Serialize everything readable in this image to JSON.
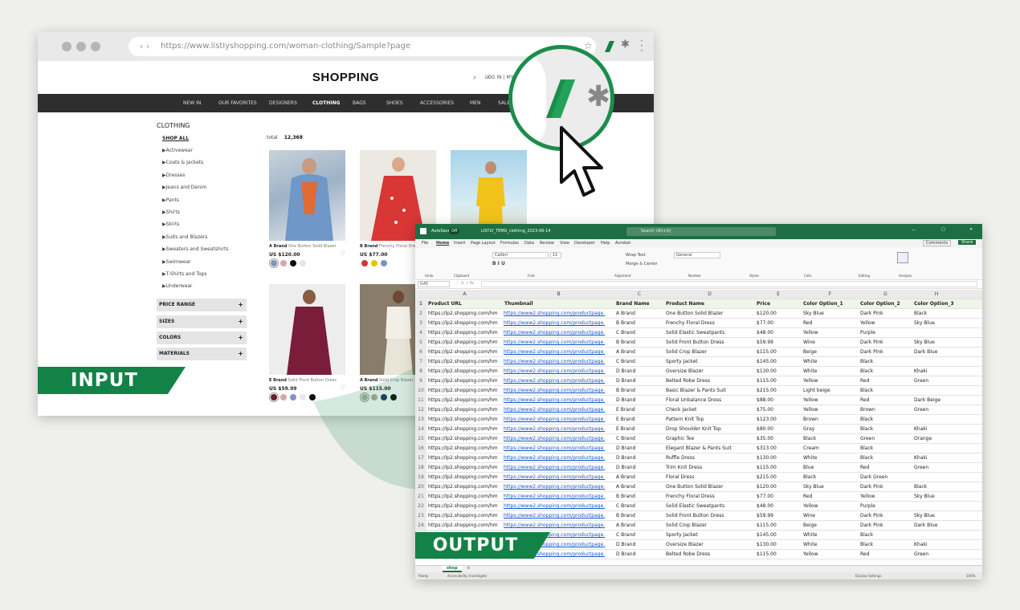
{
  "browser": {
    "url": "https://www.listlyshopping.com/woman-clothing/Sample?page",
    "logo": "SHOPPING",
    "login": "LOG IN | MY",
    "nav": [
      "NEW IN",
      "OUR FAVORITES",
      "DESIGNERS",
      "CLOTHING",
      "BAGS",
      "SHOES",
      "ACCESSORIES",
      "MEN",
      "SALE"
    ],
    "category_title": "CLOTHING",
    "shop_all": "SHOP ALL",
    "categories": [
      "Activewear",
      "Coats & Jackets",
      "Dresses",
      "Jeans and Denim",
      "Pants",
      "Shirts",
      "Skirts",
      "Suits and Blazers",
      "Sweaters and Sweatshirts",
      "Swimwear",
      "T-Shirts and Tops",
      "Underwear"
    ],
    "total_label": "total",
    "total_value": "12,368",
    "filters": [
      "PRICE RANGE",
      "SIZES",
      "COLORS",
      "MATERIALS"
    ],
    "products": [
      {
        "brand": "A Brand",
        "name": "One Button Solid Blazer",
        "price": "US $120.00",
        "swatches": [
          "#7e95b3",
          "#d9a6a6",
          "#111111",
          "#e5e5ee"
        ]
      },
      {
        "brand": "B Brand",
        "name": "Frenchy Floral Dress",
        "price": "US $77.00",
        "swatches": [
          "#d63434",
          "#e8c400",
          "#7d95c2"
        ]
      },
      {
        "brand": "",
        "name": "",
        "price": "",
        "swatches": []
      },
      {
        "brand": "E Brand",
        "name": "Solid Front Button Dress",
        "price": "US $59.99",
        "swatches": [
          "#6e1a33",
          "#d9a6a6",
          "#7d95c2",
          "#e8e8ee",
          "#111111"
        ]
      },
      {
        "brand": "A Brand",
        "name": "Solid Crop Blazer",
        "price": "US $115.00",
        "swatches": [
          "#aab3a0",
          "#b8a99d",
          "#1f3a5f",
          "#111111"
        ]
      }
    ]
  },
  "labels": {
    "input": "INPUT",
    "output": "OUTPUT"
  },
  "excel": {
    "autosave": "AutoSave",
    "autosave_state": "Off",
    "filename": "LISTLY_TEMU_clothing_2023-06-14",
    "search": "Search (Alt+Q)",
    "menu": [
      "File",
      "Home",
      "Insert",
      "Page Layout",
      "Formulas",
      "Data",
      "Review",
      "View",
      "Developer",
      "Help",
      "Acrobat"
    ],
    "comments": "Comments",
    "share": "Share",
    "ribbon_groups": [
      "Undo",
      "Clipboard",
      "Font",
      "Alignment",
      "Number",
      "Styles",
      "Cells",
      "Editing",
      "Analysis"
    ],
    "font_name": "Calibri",
    "font_size": "11",
    "number_format": "General",
    "wrap_text": "Wrap Text",
    "merge": "Merge & Center",
    "name_box": "G45",
    "col_letters": [
      "A",
      "B",
      "C",
      "D",
      "E",
      "F",
      "G",
      "H"
    ],
    "headers": [
      "Product URL",
      "Thumbnail",
      "Brand Name",
      "Product Name",
      "Price",
      "Color Option_1",
      "Color Option_2",
      "Color Option_3"
    ],
    "url_a": "https://lp2.shopping.com/hm",
    "url_b": "https://www2.shopping.com/productpage.",
    "rows": [
      [
        "A Brand",
        "One Button Solid Blazer",
        "$120.00",
        "Sky Blue",
        "Dark Pink",
        "Black"
      ],
      [
        "B Brand",
        "Frenchy Floral Dress",
        "$77.00",
        "Red",
        "Yellow",
        "Sky Blue"
      ],
      [
        "C Brand",
        "Solid Elastic Sweatpants",
        "$48.00",
        "Yellow",
        "Purple",
        ""
      ],
      [
        "B Brand",
        "Solid Front Button Dress",
        "$59.99",
        "Wine",
        "Dark Pink",
        "Sky Blue"
      ],
      [
        "A Brand",
        "Solid Crop Blazer",
        "$115.00",
        "Beige",
        "Dark Pink",
        "Dark Blue"
      ],
      [
        "C Brand",
        "Sporty Jacket",
        "$145.00",
        "White",
        "Black",
        ""
      ],
      [
        "D Brand",
        "Oversize Blazer",
        "$130.00",
        "White",
        "Black",
        "Khaki"
      ],
      [
        "D Brand",
        "Belted Robe Dress",
        "$115.00",
        "Yellow",
        "Red",
        "Green"
      ],
      [
        "B Brand",
        "Basic Blazer & Pants Suit",
        "$215.00",
        "Light beige",
        "Black",
        ""
      ],
      [
        "D Brand",
        "Floral Unbalance Dress",
        "$88.00",
        "Yellow",
        "Red",
        "Dark Beige"
      ],
      [
        "E Brand",
        "Check Jacket",
        "$75.00",
        "Yellow",
        "Brown",
        "Green"
      ],
      [
        "E Brand",
        "Pattern Knit Top",
        "$123.00",
        "Brown",
        "Black",
        ""
      ],
      [
        "E Brand",
        "Drop Shoulder Knit Top",
        "$80.00",
        "Gray",
        "Black",
        "Khaki"
      ],
      [
        "C Brand",
        "Graphic Tee",
        "$35.00",
        "Black",
        "Green",
        "Orange"
      ],
      [
        "D Brand",
        "Elegant Blazer & Pants Suit",
        "$313.00",
        "Cream",
        "Black",
        ""
      ],
      [
        "D Brand",
        "Ruffle Dress",
        "$130.00",
        "White",
        "Black",
        "Khaki"
      ],
      [
        "D Brand",
        "Trim Knit Dress",
        "$115.00",
        "Blue",
        "Red",
        "Green"
      ],
      [
        "A Brand",
        "Floral Dress",
        "$215.00",
        "Black",
        "Dark Green",
        ""
      ],
      [
        "A Brand",
        "One Button Solid Blazer",
        "$120.00",
        "Sky Blue",
        "Dark Pink",
        "Black"
      ],
      [
        "B Brand",
        "Frenchy Floral Dress",
        "$77.00",
        "Red",
        "Yellow",
        "Sky Blue"
      ],
      [
        "C Brand",
        "Solid Elastic Sweatpants",
        "$48.00",
        "Yellow",
        "Purple",
        ""
      ],
      [
        "B Brand",
        "Solid Front Button Dress",
        "$59.99",
        "Wine",
        "Dark Pink",
        "Sky Blue"
      ],
      [
        "A Brand",
        "Solid Crop Blazer",
        "$115.00",
        "Beige",
        "Dark Pink",
        "Dark Blue"
      ],
      [
        "C Brand",
        "Sporty Jacket",
        "$145.00",
        "White",
        "Black",
        ""
      ],
      [
        "D Brand",
        "Oversize Blazer",
        "$130.00",
        "White",
        "Black",
        "Khaki"
      ],
      [
        "D Brand",
        "Belted Robe Dress",
        "$115.00",
        "Yellow",
        "Red",
        "Green"
      ]
    ],
    "sheet_tab": "shop",
    "status_ready": "Ready",
    "status_access": "Accessibility: Investigate",
    "display_settings": "Display Settings",
    "zoom": "100%"
  },
  "colors": {
    "accent": "#138247",
    "excel_green": "#1d6f42"
  }
}
